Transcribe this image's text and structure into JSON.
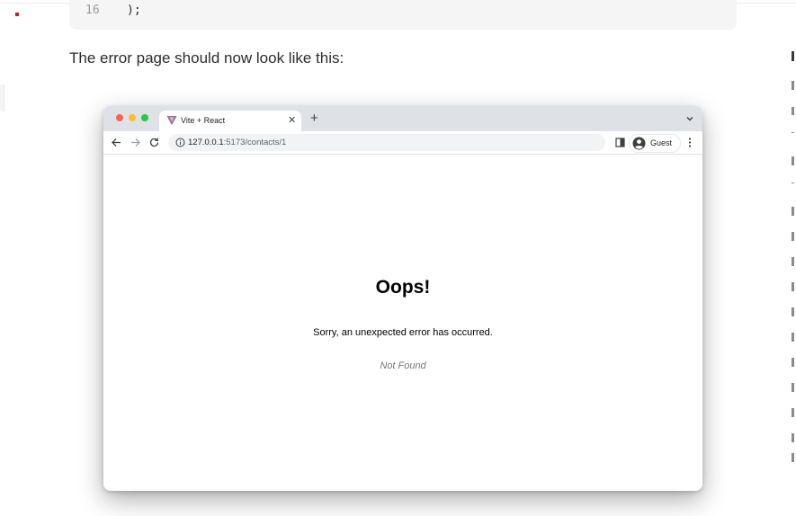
{
  "code": {
    "line_number": "16",
    "line_text": ");"
  },
  "doc": {
    "intro": "The error page should now look like this:"
  },
  "browser": {
    "tab": {
      "title": "Vite + React"
    },
    "new_tab_label": "+",
    "close_label": "✕",
    "address": {
      "host": "127.0.0.1",
      "path": ":5173/contacts/1"
    },
    "profile": {
      "label": "Guest"
    },
    "page": {
      "heading": "Oops!",
      "message": "Sorry, an unexpected error has occurred.",
      "status": "Not Found"
    }
  },
  "colors": {
    "tabstrip": "#dee1e6",
    "close_red": "#ff5f57",
    "minimize_yellow": "#febc2e",
    "zoom_green": "#28c840"
  }
}
